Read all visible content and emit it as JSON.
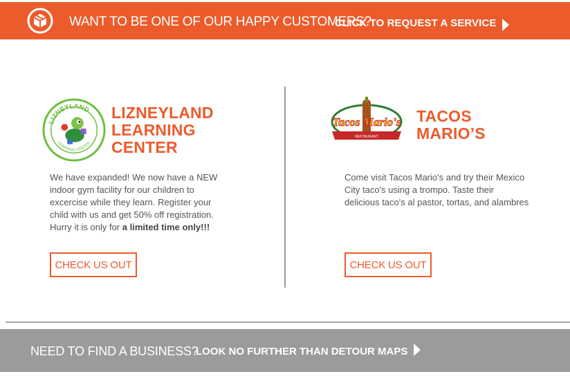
{
  "top_banner": {
    "lead": "WANT TO BE ONE OF OUR HAPPY CUSTOMERS?",
    "cta": "CLICK TO REQUEST A SERVICE",
    "icon": "package-box-icon",
    "color": "#ec5b2c"
  },
  "cards": [
    {
      "logo_text": "LIZNEYLAND",
      "logo_subtext": "LEARNING CENTER",
      "name": "LIZNEYLAND\nLEARNING\nCENTER",
      "description": "We have expanded! We now have a NEW indoor gym facility for our children to excercise while they learn. Register your child with us and get 50% off registration. Hurry it is only for ",
      "description_emphasis": "a limited time only!!!",
      "button": "CHECK US OUT"
    },
    {
      "logo_text": "Tacos Mario's",
      "logo_subtext": "RESTAURANT",
      "name": "TACOS\nMARIO’S",
      "description": "Come visit Tacos Mario's and try their Mexico City taco's using a trompo. Taste their delicious taco's al pastor, tortas, and alambres",
      "button": "CHECK US OUT"
    }
  ],
  "bottom_banner": {
    "lead": "NEED TO FIND A BUSINESS?",
    "cta": "LOOK NO FURTHER THAN DETOUR MAPS",
    "color": "#9b9b9b"
  },
  "colors": {
    "accent": "#ec5b2c",
    "text": "#555555",
    "gray_banner": "#9b9b9b"
  }
}
